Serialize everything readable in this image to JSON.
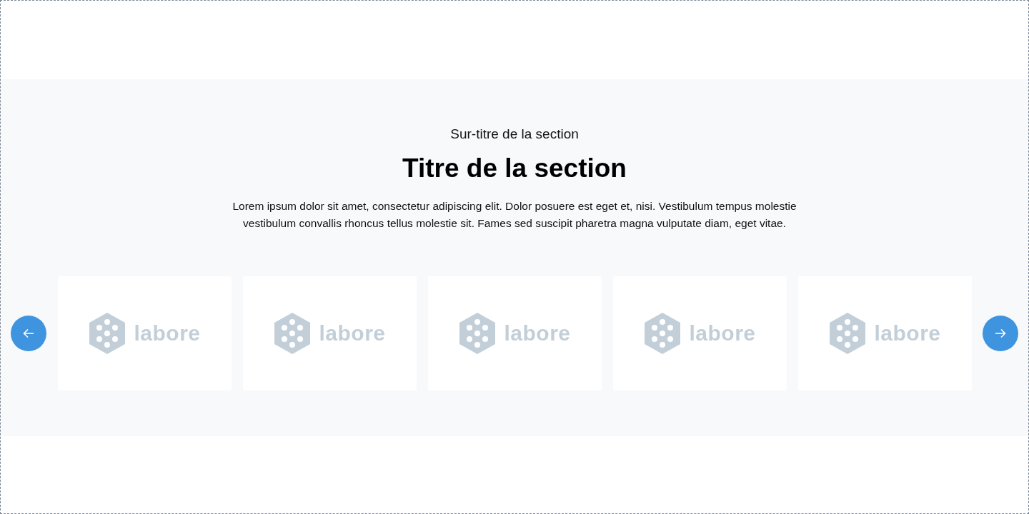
{
  "section": {
    "eyebrow": "Sur-titre de la section",
    "title": "Titre de la section",
    "description": "Lorem ipsum dolor sit amet, consectetur adipiscing elit. Dolor posuere est eget et, nisi. Vestibulum tempus molestie vestibulum convallis rhoncus tellus molestie sit. Fames sed suscipit pharetra magna vulputate diam, eget vitae."
  },
  "carousel": {
    "logos": [
      {
        "name": "labore"
      },
      {
        "name": "labore"
      },
      {
        "name": "labore"
      },
      {
        "name": "labore"
      },
      {
        "name": "labore"
      }
    ]
  }
}
